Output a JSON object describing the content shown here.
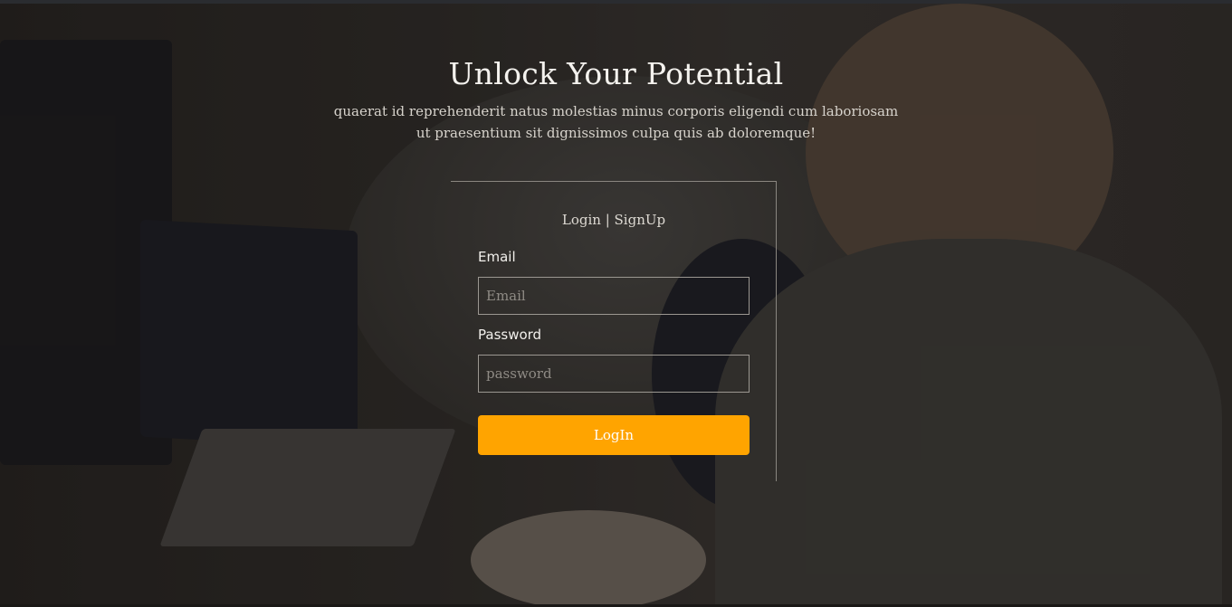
{
  "hero": {
    "title": "Unlock Your Potential",
    "subtitle": "quaerat id reprehenderit natus molestias minus corporis eligendi cum laboriosam ut praesentium sit dignissimos culpa quis ab doloremque!"
  },
  "auth": {
    "tab_login": "Login",
    "tab_separator": " | ",
    "tab_signup": "SignUp",
    "email_label": "Email",
    "email_placeholder": "Email",
    "password_label": "Password",
    "password_placeholder": "password",
    "submit_label": "LogIn"
  },
  "colors": {
    "accent": "#ffa400",
    "overlay": "#141210"
  }
}
